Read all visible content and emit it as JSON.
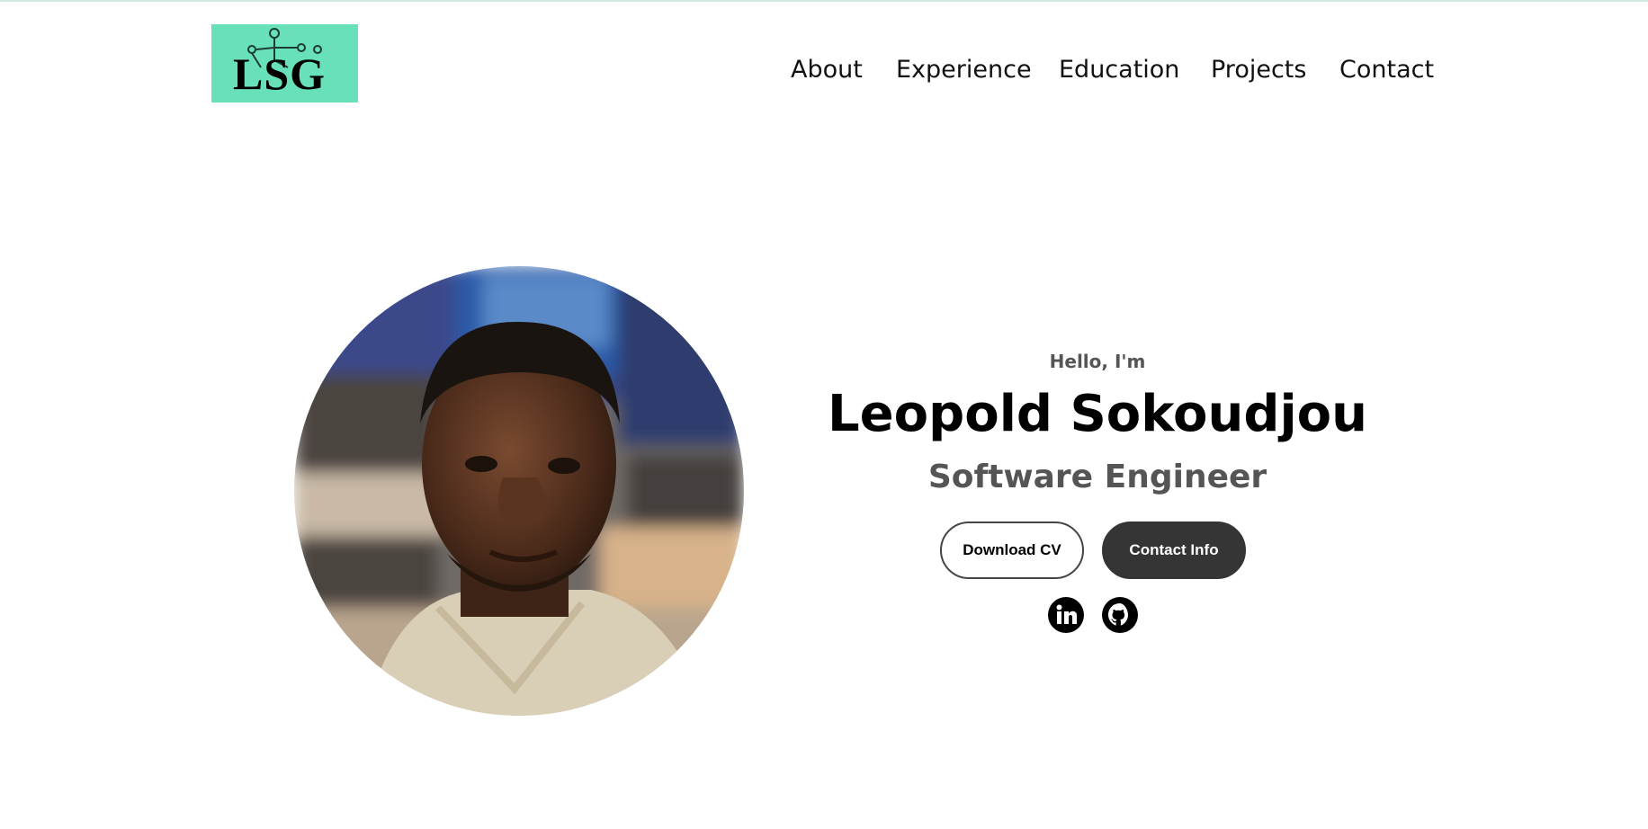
{
  "header": {
    "logo_text": "LSG",
    "logo_color": "#68e0b9",
    "nav": [
      "About",
      "Experience",
      "Education",
      "Projects",
      "Contact"
    ]
  },
  "hero": {
    "greeting": "Hello, I'm",
    "name": "Leopold Sokoudjou",
    "role": "Software Engineer",
    "buttons": {
      "download_cv": "Download CV",
      "contact_info": "Contact Info"
    },
    "social_icons": [
      "linkedin-icon",
      "github-icon"
    ]
  },
  "colors": {
    "primary_button": "#353535",
    "secondary_text": "#555555"
  }
}
